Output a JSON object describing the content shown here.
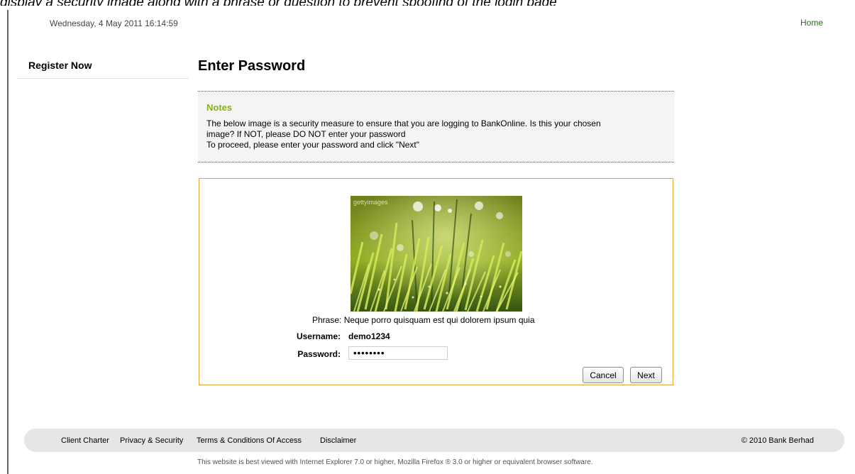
{
  "top_caption": "display a security image along with a phrase or question to prevent spoofing of the login page",
  "header": {
    "date_time": "Wednesday, 4 May 2011 16:14:59",
    "home_link": "Home"
  },
  "sidebar": {
    "register_link": "Register Now"
  },
  "main": {
    "title": "Enter Password",
    "notes": {
      "title": "Notes",
      "line1": "The below image is a security measure to ensure that you are logging to BankOnline. Is this your chosen",
      "line2": "image? If NOT, please DO NOT enter your password",
      "line3": "To proceed, please enter your password and click \"Next\""
    },
    "security_image": {
      "watermark": "gettyimages",
      "subject": "grass-with-dew"
    },
    "phrase": {
      "label": "Phrase:",
      "value": "Neque porro quisquam est qui dolorem ipsum quia"
    },
    "username": {
      "label": "Username:",
      "value": "demo1234"
    },
    "password": {
      "label": "Password:",
      "masked_value": "••••••••"
    },
    "buttons": {
      "cancel": "Cancel",
      "next": "Next"
    }
  },
  "footer": {
    "links": [
      "Client Charter",
      "Privacy & Security",
      "Terms & Conditions Of Access",
      "Disclaimer"
    ],
    "copyright": "© 2010 Bank Berhad",
    "browser_note": "This website is best viewed with Internet Explorer 7.0 or higher, Mozilla Firefox ® 3.0 or higher or equivalent browser software."
  },
  "colors": {
    "accent_green": "#7fb21b",
    "home_link": "#2f6b1f",
    "login_border": "#e7a13a",
    "footer_bg": "#e6e6e6"
  }
}
